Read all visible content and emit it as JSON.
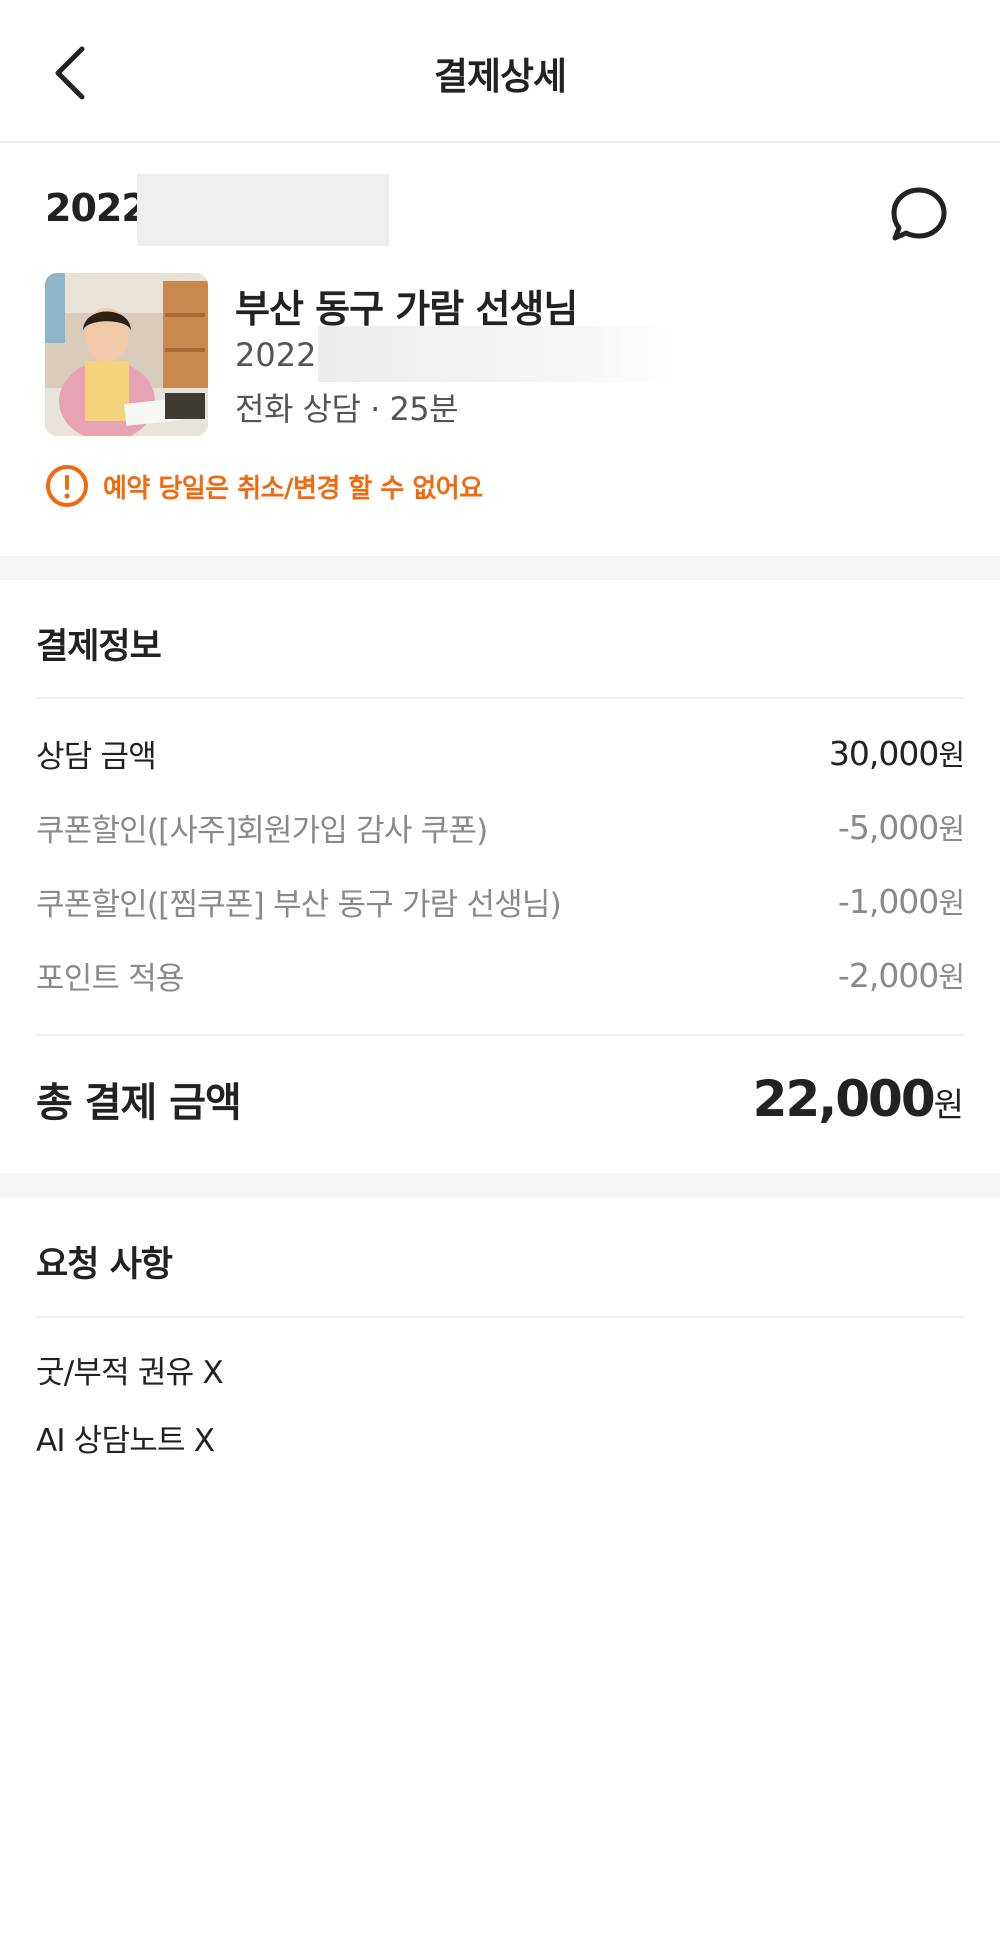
{
  "header": {
    "title": "결제상세"
  },
  "reservation": {
    "date": "2022.",
    "teacher_name": "부산 동구 가람 선생님",
    "session_date": "2022.",
    "session_type": "전화 상담 · 25분",
    "warning": "예약 당일은 취소/변경 할 수 없어요"
  },
  "payment": {
    "title": "결제정보",
    "rows": [
      {
        "label": "상담 금액",
        "amount": "30,000",
        "unit": "원"
      },
      {
        "label": "쿠폰할인([사주]회원가입 감사 쿠폰)",
        "amount": "-5,000",
        "unit": "원"
      },
      {
        "label": "쿠폰할인([찜쿠폰] 부산 동구 가람 선생님)",
        "amount": "-1,000",
        "unit": "원"
      },
      {
        "label": "포인트 적용",
        "amount": "-2,000",
        "unit": "원"
      }
    ],
    "total_label": "총 결제 금액",
    "total_amount": "22,000",
    "total_unit": "원"
  },
  "requests": {
    "title": "요청 사항",
    "items": [
      "굿/부적 권유 X",
      "AI 상담노트 X"
    ]
  },
  "colors": {
    "accent_orange": "#f06a0f",
    "text_primary": "#222222",
    "text_secondary": "#8a8a8a",
    "band_gray": "#f5f5f5"
  },
  "icons": {
    "back": "chevron-left-icon",
    "chat": "chat-bubble-icon",
    "warning": "exclamation-circle-icon"
  }
}
